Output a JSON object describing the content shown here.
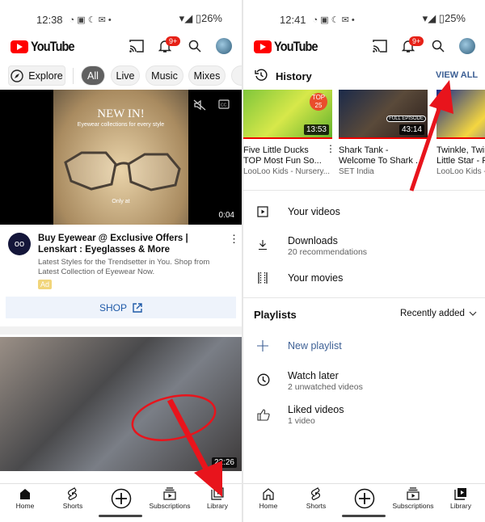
{
  "left": {
    "status": {
      "time": "12:38",
      "battery": "26%"
    },
    "header": {
      "logo": "YouTube",
      "notif_badge": "9+"
    },
    "chips": [
      {
        "label": "Explore",
        "icon": "compass-icon"
      },
      {
        "label": "All",
        "selected": true
      },
      {
        "label": "Live"
      },
      {
        "label": "Music"
      },
      {
        "label": "Mixes"
      },
      {
        "label": ""
      }
    ],
    "ad": {
      "overlay_title": "NEW IN!",
      "overlay_sub": "Eyewear collections for every style",
      "overlay_note": "Only at",
      "duration": "0:04",
      "title": "Buy Eyewear @ Exclusive Offers | Lenskart : Eyeglasses & More",
      "desc": "Latest Styles for the Trendsetter in You. Shop from Latest Collection of Eyewear Now.",
      "ad_label": "Ad",
      "shop": "SHOP"
    },
    "video2": {
      "duration": "22:26"
    },
    "nav": [
      {
        "label": "Home"
      },
      {
        "label": "Shorts"
      },
      {
        "label": ""
      },
      {
        "label": "Subscriptions"
      },
      {
        "label": "Library"
      }
    ]
  },
  "right": {
    "status": {
      "time": "12:41",
      "battery": "25%"
    },
    "header": {
      "logo": "YouTube",
      "notif_badge": "9+"
    },
    "history": {
      "title": "History",
      "view_all": "VIEW ALL",
      "items": [
        {
          "title1": "Five Little Ducks",
          "title2": "TOP Most Fun So...",
          "channel": "LooLoo Kids - Nursery...",
          "duration": "13:53",
          "badge": "TOP 25"
        },
        {
          "title1": "Shark Tank -",
          "title2": "Welcome To Shark ...",
          "channel": "SET India",
          "duration": "43:14",
          "badge": "FULL EPISODE"
        },
        {
          "title1": "Twinkle, Twinkle",
          "title2": "Little Star - F",
          "channel": "LooLoo Kids -",
          "duration": ""
        }
      ]
    },
    "library": [
      {
        "title": "Your videos",
        "sub": "",
        "icon": "play-box-icon"
      },
      {
        "title": "Downloads",
        "sub": "20 recommendations",
        "icon": "download-icon"
      },
      {
        "title": "Your movies",
        "sub": "",
        "icon": "film-icon"
      }
    ],
    "playlists": {
      "title": "Playlists",
      "sort": "Recently added",
      "new": "New playlist",
      "items": [
        {
          "title": "Watch later",
          "sub": "2 unwatched videos"
        },
        {
          "title": "Liked videos",
          "sub": "1 video"
        }
      ]
    },
    "nav": [
      {
        "label": "Home"
      },
      {
        "label": "Shorts"
      },
      {
        "label": ""
      },
      {
        "label": "Subscriptions"
      },
      {
        "label": "Library"
      }
    ]
  },
  "colors": {
    "accent": "#065fd4",
    "brand_red": "#ff0000",
    "arrow": "#e8141c"
  }
}
